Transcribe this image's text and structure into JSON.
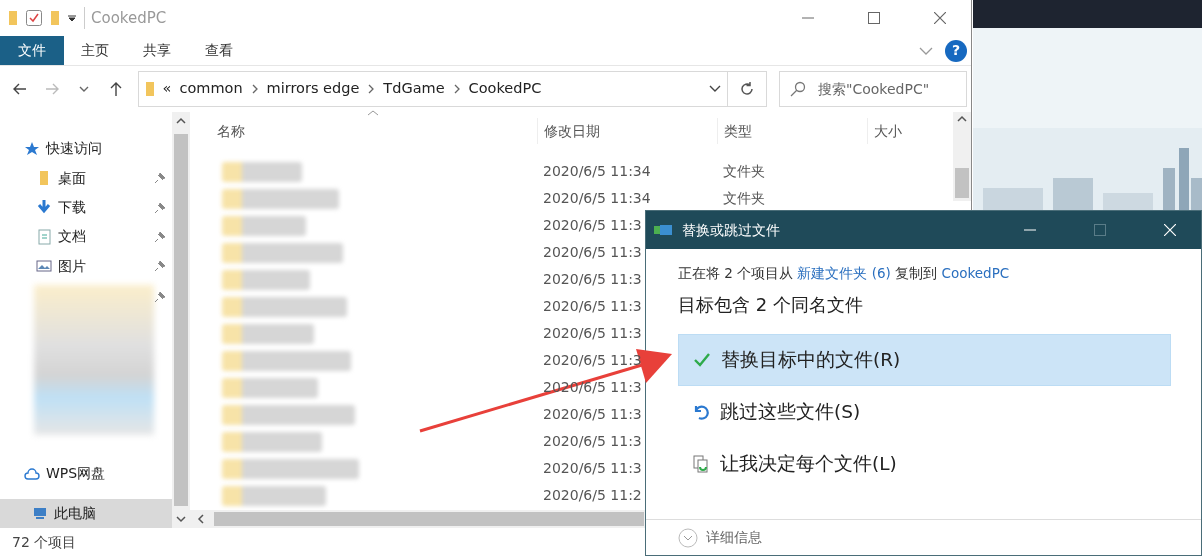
{
  "explorer": {
    "title": "CookedPC",
    "ribbon_tabs": [
      {
        "label": "文件",
        "selected": true
      },
      {
        "label": "主页",
        "selected": false
      },
      {
        "label": "共享",
        "selected": false
      },
      {
        "label": "查看",
        "selected": false
      }
    ],
    "help": "?",
    "address": {
      "overflow": "«",
      "parts": [
        "common",
        "mirrors edge",
        "TdGame",
        "CookedPC"
      ]
    },
    "search": {
      "placeholder": "搜索\"CookedPC\""
    },
    "nav": [
      {
        "label": "快速访问",
        "kind": "star",
        "pinned": false,
        "selected": false
      },
      {
        "label": "桌面",
        "kind": "folder",
        "pinned": true,
        "selected": false
      },
      {
        "label": "下载",
        "kind": "download",
        "pinned": true,
        "selected": false
      },
      {
        "label": "文档",
        "kind": "document",
        "pinned": true,
        "selected": false
      },
      {
        "label": "图片",
        "kind": "picture",
        "pinned": true,
        "selected": false
      },
      {
        "kind": "blurred",
        "pinned": true,
        "selected": false
      },
      {
        "label": "WPS网盘",
        "kind": "cloud",
        "pinned": false,
        "selected": false
      },
      {
        "label": "此电脑",
        "kind": "pc",
        "pinned": false,
        "selected": true
      }
    ],
    "columns": [
      "名称",
      "修改日期",
      "类型",
      "大小"
    ],
    "rows": [
      {
        "date": "2020/6/5 11:34",
        "type": "文件夹"
      },
      {
        "date": "2020/6/5 11:34",
        "type": "文件夹"
      },
      {
        "date": "2020/6/5 11:3"
      },
      {
        "date": "2020/6/5 11:3"
      },
      {
        "date": "2020/6/5 11:3"
      },
      {
        "date": "2020/6/5 11:3"
      },
      {
        "date": "2020/6/5 11:3"
      },
      {
        "date": "2020/6/5 11:3"
      },
      {
        "date": "2020/6/5 11:3"
      },
      {
        "date": "2020/6/5 11:3"
      },
      {
        "date": "2020/6/5 11:3"
      },
      {
        "date": "2020/6/5 11:3"
      },
      {
        "date": "2020/6/5 11:2"
      }
    ],
    "status": "72 个项目"
  },
  "dialog": {
    "title": "替换或跳过文件",
    "message": [
      {
        "text": "正在将 2 个项目从 "
      },
      {
        "text": "新建文件夹 (6)",
        "kind": "link"
      },
      {
        "text": " 复制到 "
      },
      {
        "text": "CookedPC",
        "kind": "link"
      }
    ],
    "heading": "目标包含 2 个同名文件",
    "options": [
      {
        "kind": "replace",
        "label": "替换目标中的文件(R)",
        "selected": true
      },
      {
        "kind": "skip",
        "label": "跳过这些文件(S)",
        "selected": false
      },
      {
        "kind": "decide",
        "label": "让我决定每个文件(L)",
        "selected": false
      }
    ],
    "details": "详细信息"
  }
}
